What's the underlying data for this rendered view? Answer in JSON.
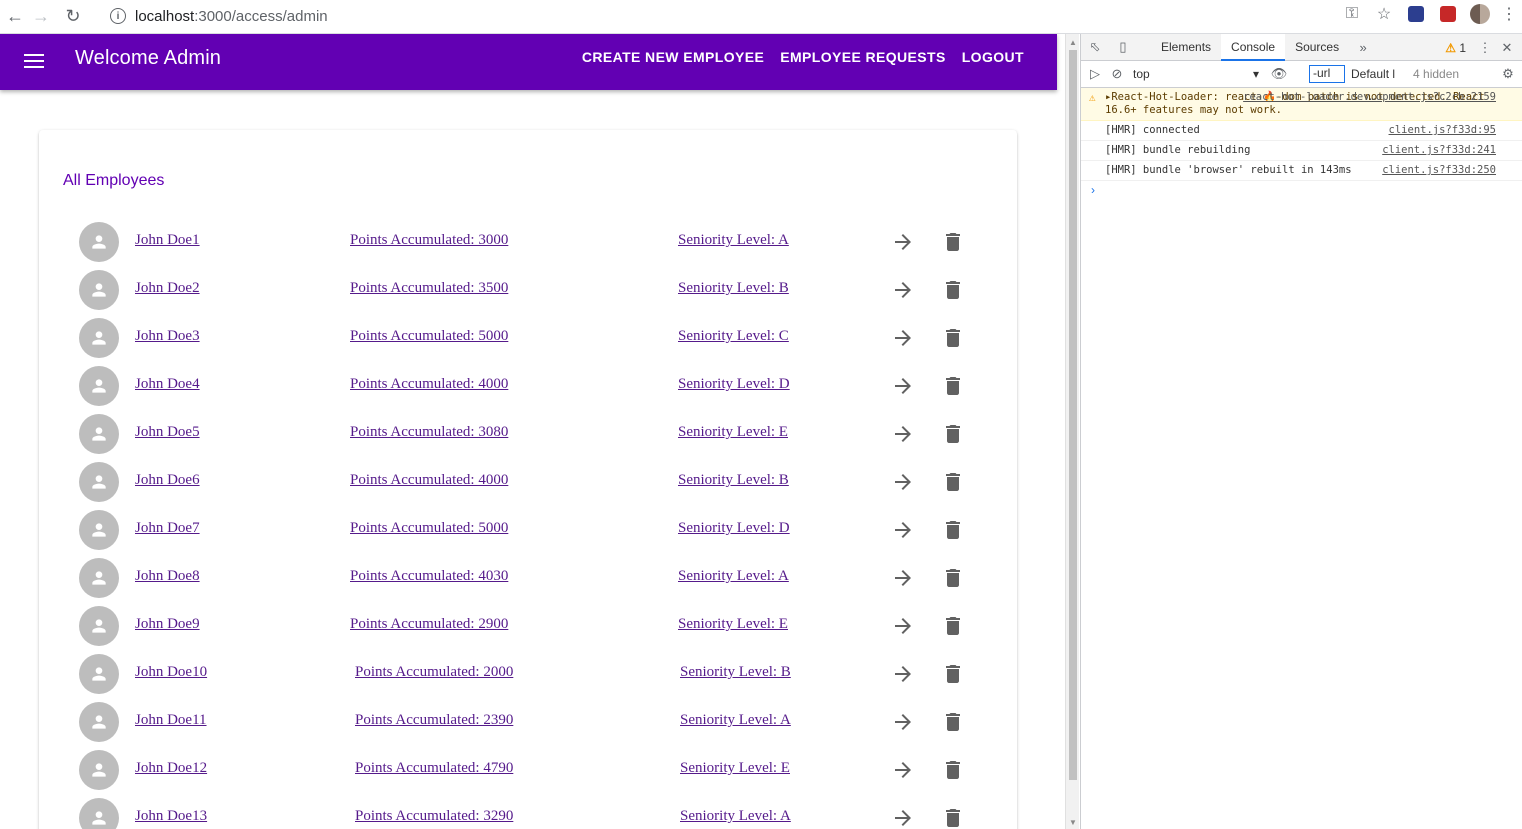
{
  "browser": {
    "url_host": "localhost",
    "url_path": ":3000/access/admin"
  },
  "appbar": {
    "title": "Welcome Admin",
    "actions": [
      "CREATE NEW EMPLOYEE",
      "EMPLOYEE REQUESTS",
      "LOGOUT"
    ]
  },
  "employees": {
    "heading": "All Employees",
    "rows": [
      {
        "name": "John Doe1",
        "points": "Points Accumulated:  3000",
        "level": "Seniority Level:  A"
      },
      {
        "name": "John Doe2",
        "points": "Points Accumulated:  3500",
        "level": "Seniority Level:  B"
      },
      {
        "name": "John Doe3",
        "points": "Points Accumulated:  5000",
        "level": "Seniority Level:  C"
      },
      {
        "name": "John Doe4",
        "points": "Points Accumulated:  4000",
        "level": "Seniority Level:  D"
      },
      {
        "name": "John Doe5",
        "points": "Points Accumulated:  3080",
        "level": "Seniority Level:  E"
      },
      {
        "name": "John Doe6",
        "points": "Points Accumulated:  4000",
        "level": "Seniority Level:  B"
      },
      {
        "name": "John Doe7",
        "points": "Points Accumulated:  5000",
        "level": "Seniority Level:  D"
      },
      {
        "name": "John Doe8",
        "points": "Points Accumulated:  4030",
        "level": "Seniority Level:  A"
      },
      {
        "name": "John Doe9",
        "points": "Points Accumulated:  2900",
        "level": "Seniority Level:  E"
      },
      {
        "name": "John Doe10",
        "points": "Points Accumulated:  2000",
        "level": "Seniority Level:  B"
      },
      {
        "name": "John Doe11",
        "points": "Points Accumulated:  2390",
        "level": "Seniority Level:  A"
      },
      {
        "name": "John Doe12",
        "points": "Points Accumulated:  4790",
        "level": "Seniority Level:  E"
      },
      {
        "name": "John Doe13",
        "points": "Points Accumulated:  3290",
        "level": "Seniority Level:  A"
      }
    ]
  },
  "devtools": {
    "tabs": [
      "Elements",
      "Console",
      "Sources"
    ],
    "warning_count": "1",
    "context": "top",
    "filter": "-url",
    "levels": "Default l",
    "hidden": "4 hidden",
    "messages": [
      {
        "type": "warning",
        "text": "▸React-Hot-Loader: react-🔥-dom patch is not detected. React 16.6+ features may not work.",
        "source": "react-hot-loader.dev…opment.js?c2cb:2159"
      },
      {
        "type": "log",
        "text": "[HMR] connected",
        "source": "client.js?f33d:95"
      },
      {
        "type": "log",
        "text": "[HMR] bundle rebuilding",
        "source": "client.js?f33d:241"
      },
      {
        "type": "log",
        "text": "[HMR] bundle 'browser' rebuilt in 143ms",
        "source": "client.js?f33d:250"
      }
    ]
  },
  "colors": {
    "appbar": "#6200b3",
    "link": "#551a8b",
    "icon": "#616161"
  }
}
